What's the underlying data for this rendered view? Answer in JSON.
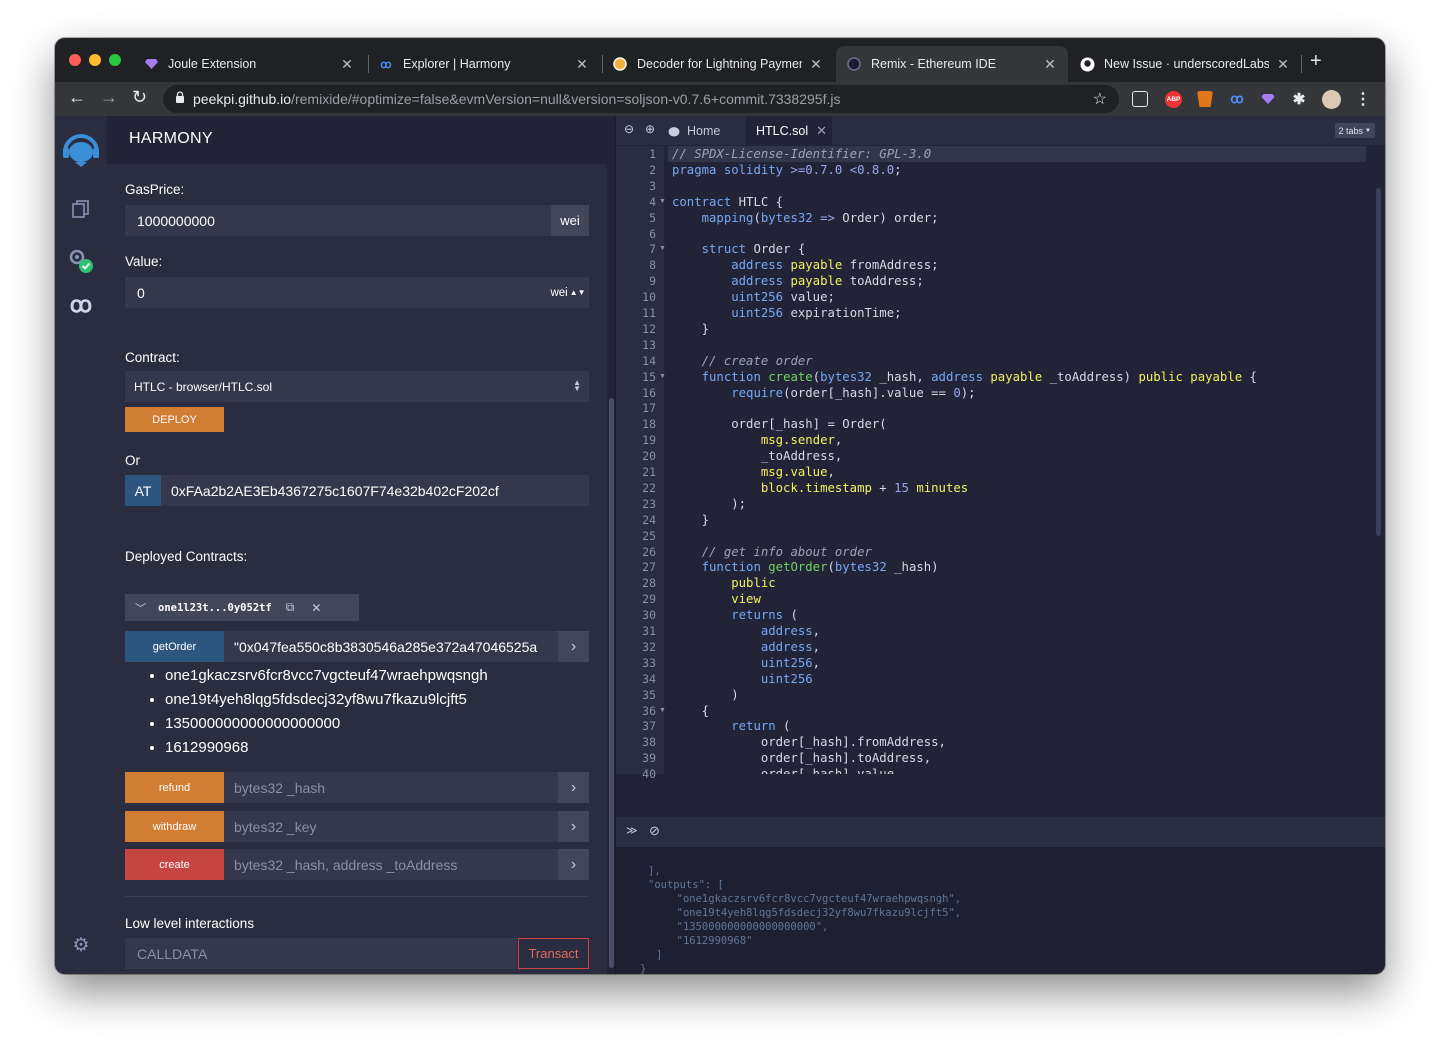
{
  "browser": {
    "tabs": [
      {
        "title": "Joule Extension",
        "icon": "joule-diamond-icon"
      },
      {
        "title": "Explorer | Harmony",
        "icon": "harmony-icon"
      },
      {
        "title": "Decoder for Lightning Paymen",
        "icon": "decoder-icon"
      },
      {
        "title": "Remix - Ethereum IDE",
        "icon": "remix-icon"
      },
      {
        "title": "New Issue · underscoredLabs/",
        "icon": "github-icon"
      }
    ],
    "close_glyph": "✕",
    "new_tab_glyph": "+",
    "url_host": "peekpi.github.io",
    "url_path": "/remixide/#optimize=false&evmVersion=null&version=soljson-v0.7.6+commit.7338295f.js",
    "extensions": [
      "pocket-icon",
      "adblock-icon",
      "metamask-icon",
      "harmony-icon",
      "joule-icon",
      "extensions-icon",
      "profile-icon",
      "menu-icon"
    ],
    "adblock_label": "ABP"
  },
  "plugin": {
    "title": "HARMONY",
    "gas_price_label": "GasPrice:",
    "gas_price_value": "1000000000",
    "gas_price_unit": "wei",
    "value_label": "Value:",
    "value_value": "0",
    "value_unit": "wei",
    "contract_label": "Contract:",
    "contract_selected": "HTLC - browser/HTLC.sol",
    "deploy_label": "DEPLOY",
    "or_label": "Or",
    "at_label": "AT",
    "at_address": "0xFAa2b2AE3Eb4367275c1607F74e32b402cF202cf",
    "deployed_label": "Deployed Contracts:",
    "instance_name": "one1l23t...0y052tf",
    "get_order": {
      "label": "getOrder",
      "input": "\"0x047fea550c8b3830546a285e372a47046525a"
    },
    "results": [
      "one1gkaczsrv6fcr8vcc7vgcteuf47wraehpwqsngh",
      "one19t4yeh8lqg5fdsdecj32yf8wu7fkazu9lcjft5",
      "135000000000000000000",
      "1612990968"
    ],
    "functions": [
      {
        "label": "refund",
        "placeholder": "bytes32 _hash",
        "color": "#d17d34"
      },
      {
        "label": "withdraw",
        "placeholder": "bytes32 _key",
        "color": "#d17d34"
      },
      {
        "label": "create",
        "placeholder": "bytes32 _hash, address _toAddress",
        "color": "#c64541"
      }
    ],
    "low_level_label": "Low level interactions",
    "calldata_placeholder": "CALLDATA",
    "transact_label": "Transact"
  },
  "editor": {
    "home_tab": "Home",
    "file_tab": "HTLC.sol",
    "tabs_badge": "2 tabs",
    "code_lines": [
      "// SPDX-License-Identifier: GPL-3.0",
      "pragma solidity >=0.7.0 <0.8.0;",
      "",
      "contract HTLC {",
      "    mapping(bytes32 => Order) order;",
      "",
      "    struct Order {",
      "        address payable fromAddress;",
      "        address payable toAddress;",
      "        uint256 value;",
      "        uint256 expirationTime;",
      "    }",
      "",
      "    // create order",
      "    function create(bytes32 _hash, address payable _toAddress) public payable {",
      "        require(order[_hash].value == 0);",
      "",
      "        order[_hash] = Order(",
      "            msg.sender,",
      "            _toAddress,",
      "            msg.value,",
      "            block.timestamp + 15 minutes",
      "        );",
      "    }",
      "",
      "    // get info about order",
      "    function getOrder(bytes32 _hash)",
      "        public",
      "        view",
      "        returns (",
      "            address,",
      "            address,",
      "            uint256,",
      "            uint256",
      "        )",
      "    {",
      "        return (",
      "            order[_hash].fromAddress,",
      "            order[_hash].toAddress,",
      "            order[_hash].value"
    ],
    "fold_lines": [
      4,
      7,
      15,
      36
    ]
  },
  "terminal": {
    "lines": [
      "],",
      "\"outputs\": [",
      "  \"one1gkaczsrv6fcr8vcc7vgcteuf47wraehpwqsngh\",",
      "  \"one19t4yeh8lqg5fdsdecj32yf8wu7fkazu9lcjft5\",",
      "  \"135000000000000000000\",",
      "  \"1612990968\"",
      "]",
      "}"
    ],
    "prompt": ">"
  },
  "colors": {
    "accent_orange": "#d17d34",
    "accent_red": "#c64541",
    "accent_blue": "#2c5680",
    "background": "#222336"
  }
}
